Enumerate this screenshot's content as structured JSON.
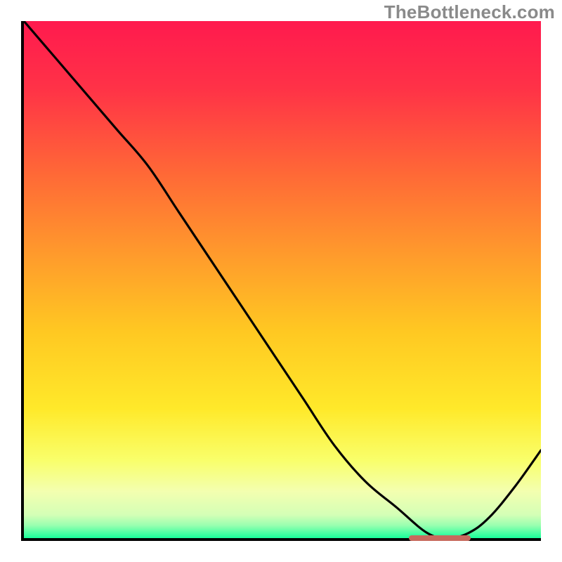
{
  "watermark": "TheBottleneck.com",
  "chart_data": {
    "type": "line",
    "title": "",
    "xlabel": "",
    "ylabel": "",
    "xlim": [
      0,
      100
    ],
    "ylim": [
      0,
      100
    ],
    "grid": false,
    "legend": false,
    "gradient_stops": [
      {
        "offset": 0.0,
        "color": "#ff1a4e"
      },
      {
        "offset": 0.13,
        "color": "#ff3247"
      },
      {
        "offset": 0.3,
        "color": "#ff6a36"
      },
      {
        "offset": 0.45,
        "color": "#ff9a2c"
      },
      {
        "offset": 0.6,
        "color": "#ffc822"
      },
      {
        "offset": 0.75,
        "color": "#ffe92a"
      },
      {
        "offset": 0.85,
        "color": "#f9ff6b"
      },
      {
        "offset": 0.91,
        "color": "#f3ffb0"
      },
      {
        "offset": 0.955,
        "color": "#d4ffb6"
      },
      {
        "offset": 0.975,
        "color": "#9affb0"
      },
      {
        "offset": 1.0,
        "color": "#18ff9a"
      }
    ],
    "series": [
      {
        "name": "curve",
        "x": [
          0,
          6,
          12,
          18,
          24,
          30,
          36,
          42,
          48,
          54,
          60,
          66,
          72,
          78,
          82,
          86,
          90,
          95,
          100
        ],
        "y": [
          100,
          93,
          86,
          79,
          72,
          63,
          54,
          45,
          36,
          27,
          18,
          11,
          6,
          1,
          0,
          1,
          4,
          10,
          17
        ]
      }
    ],
    "marker": {
      "x_start": 74,
      "x_end": 86,
      "y": 0.5,
      "color": "#c86a5d"
    }
  }
}
